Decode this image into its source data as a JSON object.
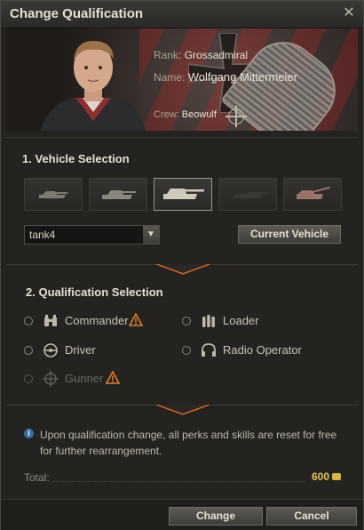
{
  "window": {
    "title": "Change Qualification"
  },
  "crew_member": {
    "rank_label": "Rank:",
    "rank_value": "Grossadmiral",
    "name_label": "Name:",
    "name_value": "Wolfgang Mittermeier",
    "crew_label": "Crew:",
    "crew_value": "Beowulf"
  },
  "vehicle_selection": {
    "title": "1. Vehicle Selection",
    "tank_slots": [
      {
        "kind": "light-tank",
        "selected": false
      },
      {
        "kind": "medium-tank",
        "selected": false
      },
      {
        "kind": "heavy-tank",
        "selected": true
      },
      {
        "kind": "tank-destroyer",
        "selected": false
      },
      {
        "kind": "spg",
        "selected": false
      }
    ],
    "dropdown_value": "tank4",
    "current_vehicle_button": "Current Vehicle"
  },
  "qualification_selection": {
    "title": "2. Qualification Selection",
    "options": {
      "commander": "Commander",
      "loader": "Loader",
      "driver": "Driver",
      "radio_operator": "Radio Operator",
      "gunner": "Gunner"
    }
  },
  "note": "Upon qualification change, all perks and skills are reset for free for further rearrangement.",
  "total": {
    "label": "Total:",
    "value": "600"
  },
  "footer": {
    "change_button": "Change",
    "cancel_button": "Cancel"
  },
  "colors": {
    "accent_gold": "#e8c547",
    "warning_orange": "#e07b27",
    "notch_orange": "#d8651f"
  }
}
